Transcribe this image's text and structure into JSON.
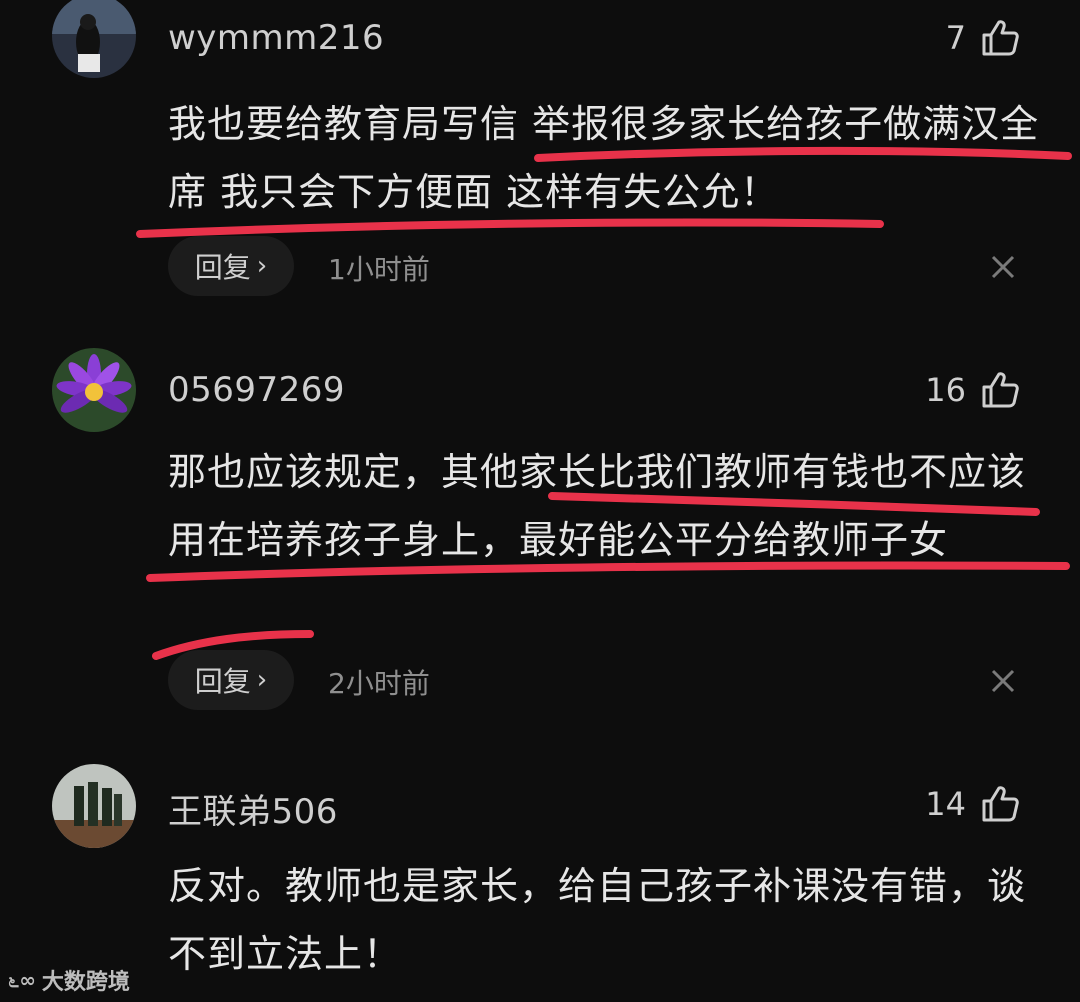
{
  "comments": [
    {
      "username": "wymmm216",
      "likes": "7",
      "text": "我也要给教育局写信 举报很多家长给孩子做满汉全席 我只会下方便面 这样有失公允！",
      "reply_label": "回复",
      "time": "1小时前"
    },
    {
      "username": "05697269",
      "likes": "16",
      "text": "那也应该规定，其他家长比我们教师有钱也不应该用在培养孩子身上，最好能公平分给教师子女",
      "reply_label": "回复",
      "time": "2小时前"
    },
    {
      "username": "王联弟506",
      "likes": "14",
      "text": "反对。教师也是家长，给自己孩子补课没有错，谈不到立法上！"
    }
  ],
  "watermark": "大数跨境",
  "colors": {
    "background": "#0d0d0d",
    "underline": "#e8324a",
    "text": "#e6e6e6"
  },
  "icons": [
    "thumbs-up-icon",
    "chevron-right-icon",
    "close-icon"
  ]
}
